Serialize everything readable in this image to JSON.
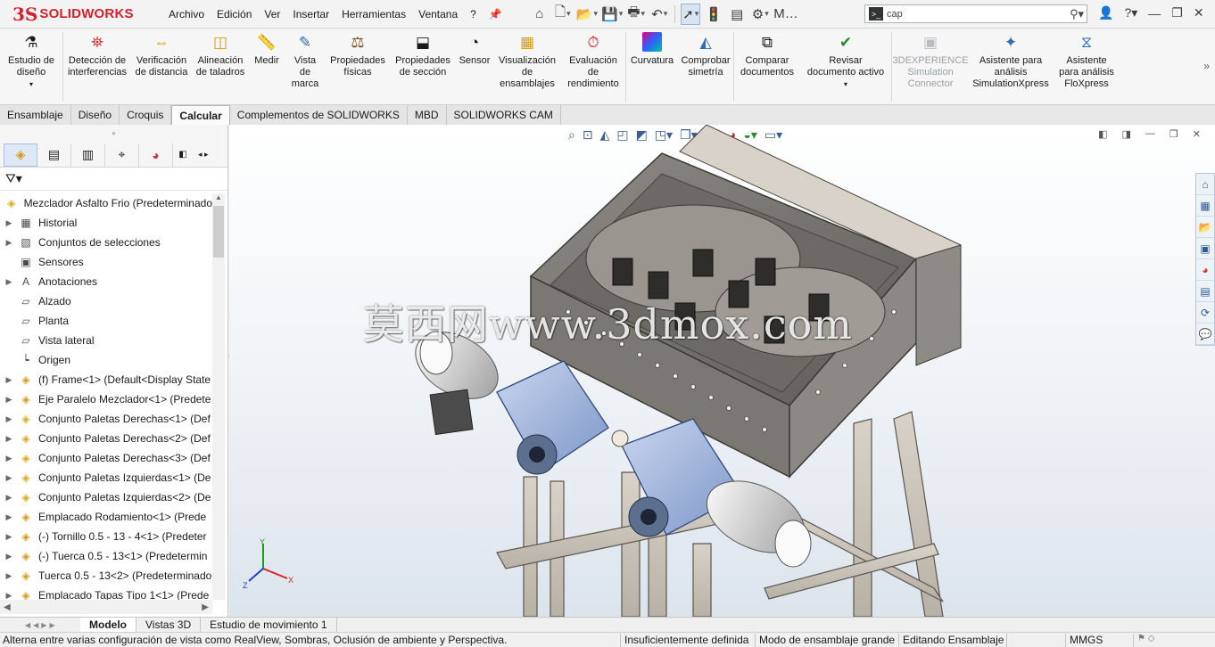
{
  "app": {
    "logo_ds": "3S",
    "logo_name": "SOLIDWORKS"
  },
  "menu": [
    "Archivo",
    "Edición",
    "Ver",
    "Insertar",
    "Herramientas",
    "Ventana",
    "?"
  ],
  "search": {
    "value": "cap"
  },
  "ribbon": [
    {
      "label": "Estudio de diseño",
      "icon": "design-study-icon",
      "dim": false
    },
    {
      "label": "Detección de interferencias",
      "icon": "interference-icon",
      "dim": false
    },
    {
      "label": "Verificación de distancia",
      "icon": "clearance-icon",
      "dim": false
    },
    {
      "label": "Alineación de taladros",
      "icon": "hole-alignment-icon",
      "dim": false
    },
    {
      "label": "Medir",
      "icon": "measure-icon",
      "dim": false
    },
    {
      "label": "Vista de marca",
      "icon": "markup-icon",
      "dim": false
    },
    {
      "label": "Propiedades físicas",
      "icon": "mass-properties-icon",
      "dim": false
    },
    {
      "label": "Propiedades de sección",
      "icon": "section-properties-icon",
      "dim": false
    },
    {
      "label": "Sensor",
      "icon": "sensor-icon",
      "dim": false
    },
    {
      "label": "Visualización de ensamblajes",
      "icon": "assembly-visualization-icon",
      "dim": false
    },
    {
      "label": "Evaluación de rendimiento",
      "icon": "performance-icon",
      "dim": false
    },
    {
      "label": "Curvatura",
      "icon": "curvature-icon",
      "dim": false
    },
    {
      "label": "Comprobar simetría",
      "icon": "symmetry-icon",
      "dim": false
    },
    {
      "label": "Comparar documentos",
      "icon": "compare-icon",
      "dim": false
    },
    {
      "label": "Revisar documento activo",
      "icon": "check-document-icon",
      "dim": false
    },
    {
      "label": "3DEXPERIENCE Simulation Connector",
      "icon": "simulation-connector-icon",
      "dim": true
    },
    {
      "label": "Asistente para análisis SimulationXpress",
      "icon": "simxpress-icon",
      "dim": false
    },
    {
      "label": "Asistente para análisis FloXpress",
      "icon": "floxpress-icon",
      "dim": false
    }
  ],
  "tabs": [
    "Ensamblaje",
    "Diseño",
    "Croquis",
    "Calcular",
    "Complementos de SOLIDWORKS",
    "MBD",
    "SOLIDWORKS CAM"
  ],
  "active_tab": "Calcular",
  "tree": {
    "root": "Mezclador Asfalto Frio  (Predeterminado",
    "items": [
      {
        "label": "Historial",
        "icon": "history-folder-icon",
        "exp": true
      },
      {
        "label": "Conjuntos de selecciones",
        "icon": "selection-sets-icon",
        "exp": true
      },
      {
        "label": "Sensores",
        "icon": "sensors-folder-icon",
        "exp": false
      },
      {
        "label": "Anotaciones",
        "icon": "annotations-icon",
        "exp": true
      },
      {
        "label": "Alzado",
        "icon": "plane-icon",
        "exp": false
      },
      {
        "label": "Planta",
        "icon": "plane-icon",
        "exp": false
      },
      {
        "label": "Vista lateral",
        "icon": "plane-icon",
        "exp": false
      },
      {
        "label": "Origen",
        "icon": "origin-icon",
        "exp": false
      },
      {
        "label": "(f) Frame<1> (Default<Display State",
        "icon": "part-icon",
        "exp": true
      },
      {
        "label": "Eje Paralelo Mezclador<1> (Predete",
        "icon": "part-icon",
        "exp": true
      },
      {
        "label": "Conjunto Paletas Derechas<1> (Def",
        "icon": "subassembly-icon",
        "exp": true
      },
      {
        "label": "Conjunto Paletas Derechas<2> (Def",
        "icon": "subassembly-icon",
        "exp": true
      },
      {
        "label": "Conjunto Paletas Derechas<3> (Def",
        "icon": "subassembly-icon",
        "exp": true
      },
      {
        "label": "Conjunto Paletas Izquierdas<1> (De",
        "icon": "subassembly-icon",
        "exp": true
      },
      {
        "label": "Conjunto Paletas Izquierdas<2> (De",
        "icon": "subassembly-icon",
        "exp": true
      },
      {
        "label": "Emplacado Rodamiento<1> (Prede",
        "icon": "part-icon",
        "exp": true
      },
      {
        "label": "(-) Tornillo 0.5 - 13 - 4<1> (Predeter",
        "icon": "part-icon",
        "exp": true
      },
      {
        "label": "(-) Tuerca 0.5 - 13<1> (Predetermin",
        "icon": "part-icon",
        "exp": true
      },
      {
        "label": "Tuerca 0.5 - 13<2> (Predeterminado",
        "icon": "part-icon",
        "exp": true
      },
      {
        "label": "Emplacado Tapas Tipo 1<1> (Prede",
        "icon": "part-icon",
        "exp": true
      }
    ]
  },
  "watermark": "莫西网www.3dmox.com",
  "triad": {
    "y": "Y",
    "x": "X",
    "z": "Z"
  },
  "bottom_tabs": [
    "Modelo",
    "Vistas 3D",
    "Estudio de movimiento 1"
  ],
  "active_bottom_tab": "Modelo",
  "status": {
    "message": "Alterna entre varias configuración de vista como RealView, Sombras, Oclusión de ambiente y Perspectiva.",
    "definition": "Insuficientemente definida",
    "mode": "Modo de ensamblaje grande",
    "editing": "Editando Ensamblaje",
    "units": "MMGS"
  }
}
